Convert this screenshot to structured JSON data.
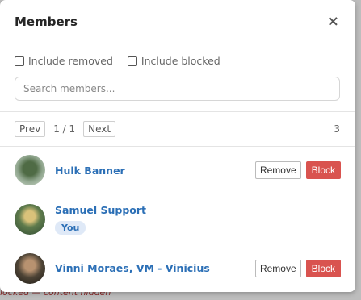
{
  "background": {
    "hidden_text": "locked — content hidden"
  },
  "modal": {
    "title": "Members",
    "close_label": "×"
  },
  "filters": {
    "include_removed": "Include removed",
    "include_blocked": "Include blocked",
    "search_placeholder": "Search members..."
  },
  "pager": {
    "prev": "Prev",
    "info": "1 / 1",
    "next": "Next",
    "count": "3"
  },
  "members": [
    {
      "name": "Hulk Banner",
      "remove": "Remove",
      "block": "Block"
    },
    {
      "name": "Samuel Support",
      "badge": "You"
    },
    {
      "name": "Vinni Moraes, VM - Vinicius",
      "remove": "Remove",
      "block": "Block"
    }
  ],
  "colors": {
    "link": "#2b6fb6",
    "danger": "#d9534f",
    "badge_bg": "#dfe9f7"
  }
}
